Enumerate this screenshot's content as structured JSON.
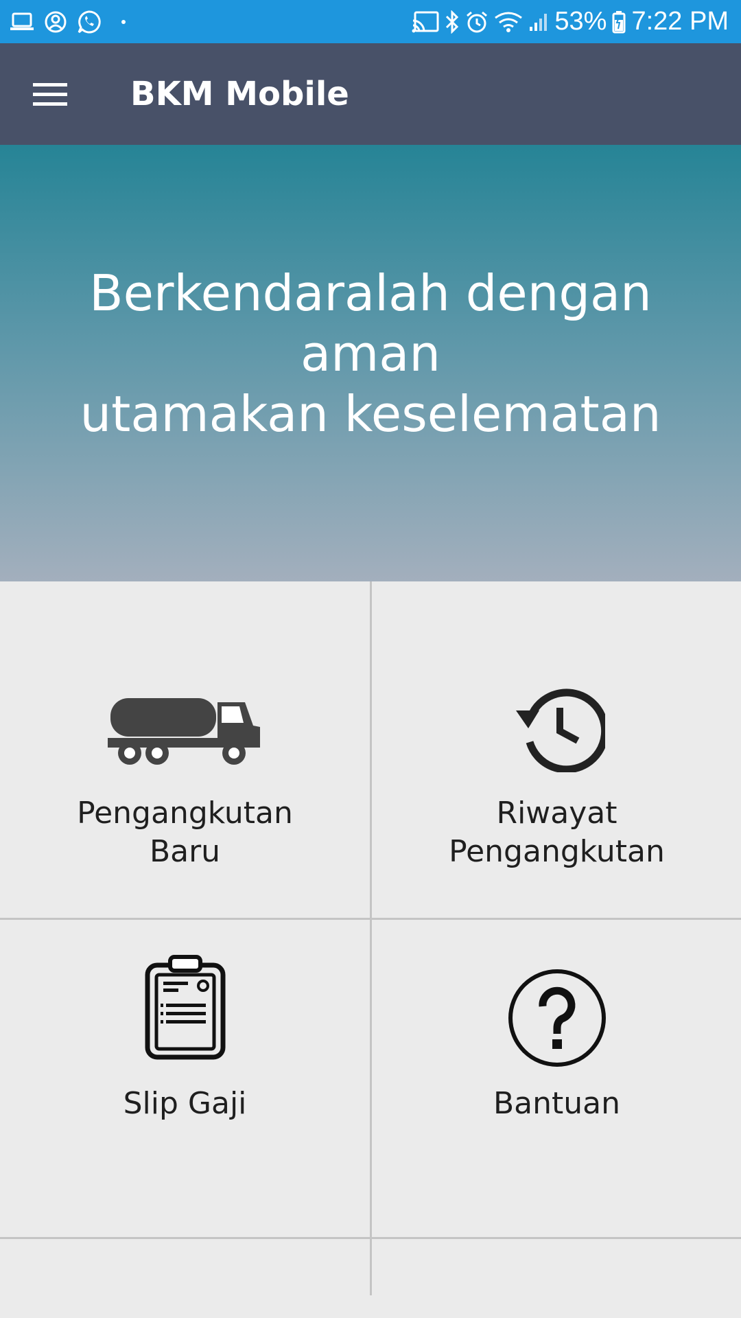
{
  "status_bar": {
    "battery": "53%",
    "time": "7:22 PM",
    "left_icons": [
      "laptop-icon",
      "account-circle-icon",
      "whatsapp-icon",
      "dot-icon"
    ],
    "right_icons": [
      "cast-icon",
      "bluetooth-icon",
      "alarm-icon",
      "wifi-icon",
      "signal-icon",
      "battery-charging-icon"
    ]
  },
  "app_bar": {
    "title": "BKM Mobile",
    "menu_icon": "hamburger-menu-icon"
  },
  "banner": {
    "line1": "Berkendaralah dengan aman",
    "line2": "utamakan keselematan"
  },
  "menu": [
    {
      "line1": "Pengangkutan",
      "line2": "Baru",
      "icon": "tanker-truck-icon"
    },
    {
      "line1": "Riwayat",
      "line2": "Pengangkutan",
      "icon": "history-icon"
    },
    {
      "line1": "Slip Gaji",
      "icon": "clipboard-icon"
    },
    {
      "line1": "Bantuan",
      "icon": "help-circle-icon"
    }
  ],
  "colors": {
    "status_bar": "#1e96dd",
    "app_bar": "#485168",
    "banner_top": "#268496",
    "banner_bottom": "#a3afbd",
    "grid_background": "#ebebeb",
    "divider": "#c4c4c4",
    "icon": "#222222"
  }
}
